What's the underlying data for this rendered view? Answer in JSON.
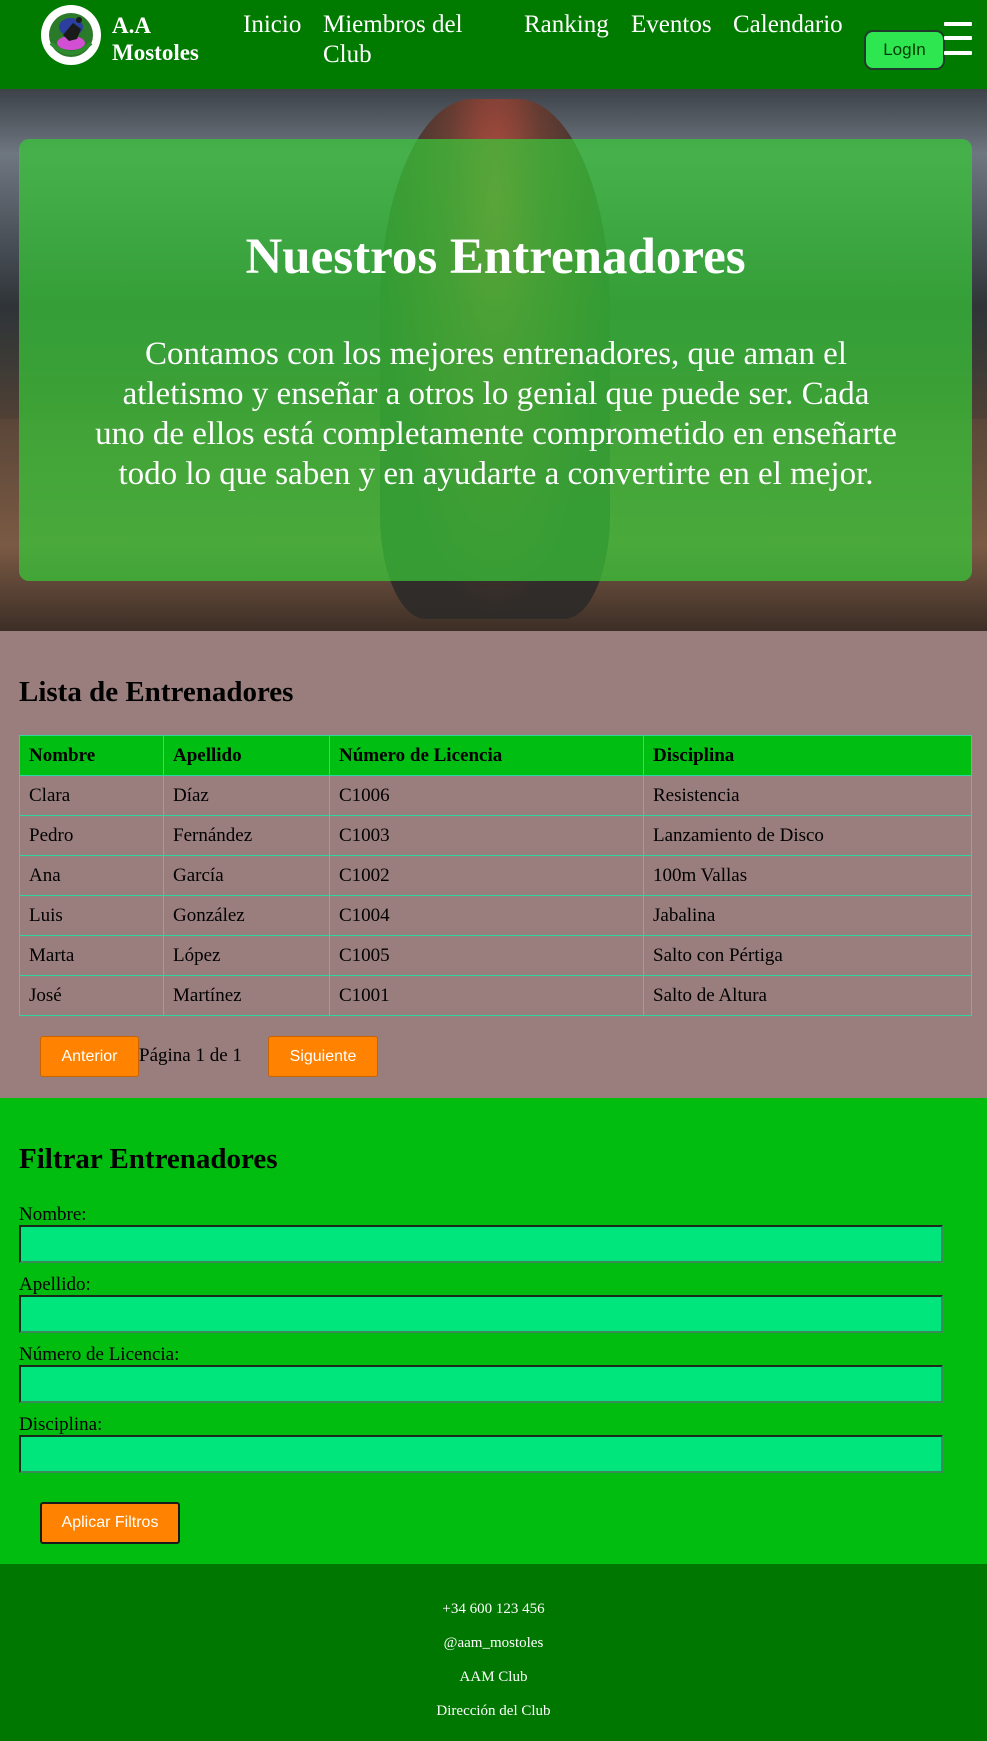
{
  "nav": {
    "brand_line1": "A.A",
    "brand_line2": "Mostoles",
    "links": [
      "Inicio",
      "Miembros del",
      "Club",
      "Ranking",
      "Eventos",
      "Calendario"
    ],
    "login": "LogIn",
    "logo_icon": "club-logo-icon",
    "menu_icon": "hamburger-menu-icon"
  },
  "hero": {
    "title": "Nuestros Entrenadores",
    "lines": [
      "Contamos con los mejores entrenadores, que aman el",
      "atletismo y enseñar a otros lo genial que puede ser. Cada",
      "uno de ellos está completamente comprometido en enseñarte",
      "todo lo que saben y en ayudarte a convertirte en el mejor."
    ]
  },
  "list": {
    "title": "Lista de Entrenadores",
    "columns": [
      "Nombre",
      "Apellido",
      "Número de Licencia",
      "Disciplina"
    ],
    "rows": [
      [
        "Clara",
        "Díaz",
        "C1006",
        "Resistencia"
      ],
      [
        "Pedro",
        "Fernández",
        "C1003",
        "Lanzamiento de Disco"
      ],
      [
        "Ana",
        "García",
        "C1002",
        "100m Vallas"
      ],
      [
        "Luis",
        "González",
        "C1004",
        "Jabalina"
      ],
      [
        "Marta",
        "López",
        "C1005",
        "Salto con Pértiga"
      ],
      [
        "José",
        "Martínez",
        "C1001",
        "Salto de Altura"
      ]
    ],
    "prev": "Anterior",
    "page_info": "Página 1 de 1",
    "next": "Siguiente"
  },
  "filter": {
    "title": "Filtrar Entrenadores",
    "labels": [
      "Nombre:",
      "Apellido:",
      "Número de Licencia:",
      "Disciplina:"
    ],
    "values": [
      "",
      "",
      "",
      ""
    ],
    "apply": "Aplicar Filtros"
  },
  "footer": {
    "phone": "+34 600 123 456",
    "social": "@aam_mostoles",
    "name": "AAM Club",
    "address": "Dirección del Club"
  },
  "colors": {
    "nav_bg": "#007b00",
    "accent_orange": "#ff8200",
    "table_header": "#00be12",
    "input_bg": "#00e67d",
    "list_bg": "#9a7d7d",
    "filter_bg": "#00bd10"
  }
}
